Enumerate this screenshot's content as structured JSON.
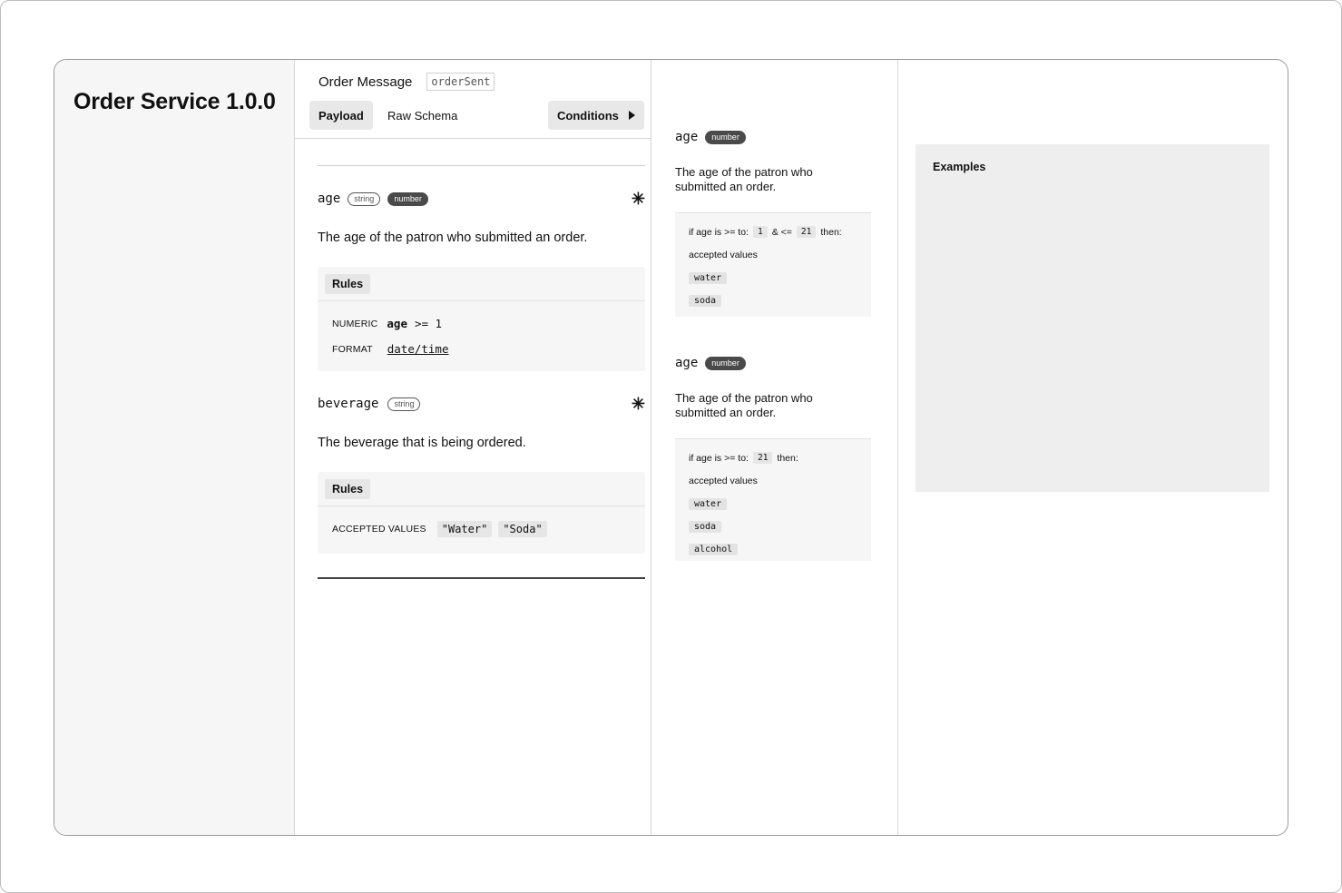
{
  "app": {
    "title": "Order Service 1.0.0"
  },
  "message": {
    "title": "Order Message",
    "id": "orderSent"
  },
  "tabs": {
    "payload": "Payload",
    "raw_schema": "Raw Schema",
    "conditions": "Conditions"
  },
  "properties": [
    {
      "name": "age",
      "types": [
        "string",
        "number"
      ],
      "required_marker": "✳",
      "description": "The age of the patron who submitted an order.",
      "rules_label": "Rules",
      "rules": [
        {
          "key": "NUMERIC",
          "field": "age",
          "op_value": ">= 1"
        },
        {
          "key": "FORMAT",
          "value": "date/time"
        }
      ]
    },
    {
      "name": "beverage",
      "types": [
        "string"
      ],
      "required_marker": "✳",
      "description": "The beverage that is being ordered.",
      "rules_label": "Rules",
      "accepted_key": "ACCEPTED VALUES",
      "accepted_values": [
        "\"Water\"",
        "\"Soda\""
      ]
    }
  ],
  "conditions": [
    {
      "name": "age",
      "type": "number",
      "description": "The age of the patron who submitted an order.",
      "if_prefix": "if age is >= to:",
      "min": "1",
      "and_op": "& <=",
      "max": "21",
      "then": "then:",
      "accepted_label": "accepted values",
      "values": [
        "water",
        "soda"
      ]
    },
    {
      "name": "age",
      "type": "number",
      "description": "The age of the patron who submitted an order.",
      "if_prefix": "if age is >= to:",
      "min": "21",
      "then": "then:",
      "accepted_label": "accepted values",
      "values": [
        "water",
        "soda",
        "alcohol"
      ]
    }
  ],
  "examples": {
    "label": "Examples"
  }
}
